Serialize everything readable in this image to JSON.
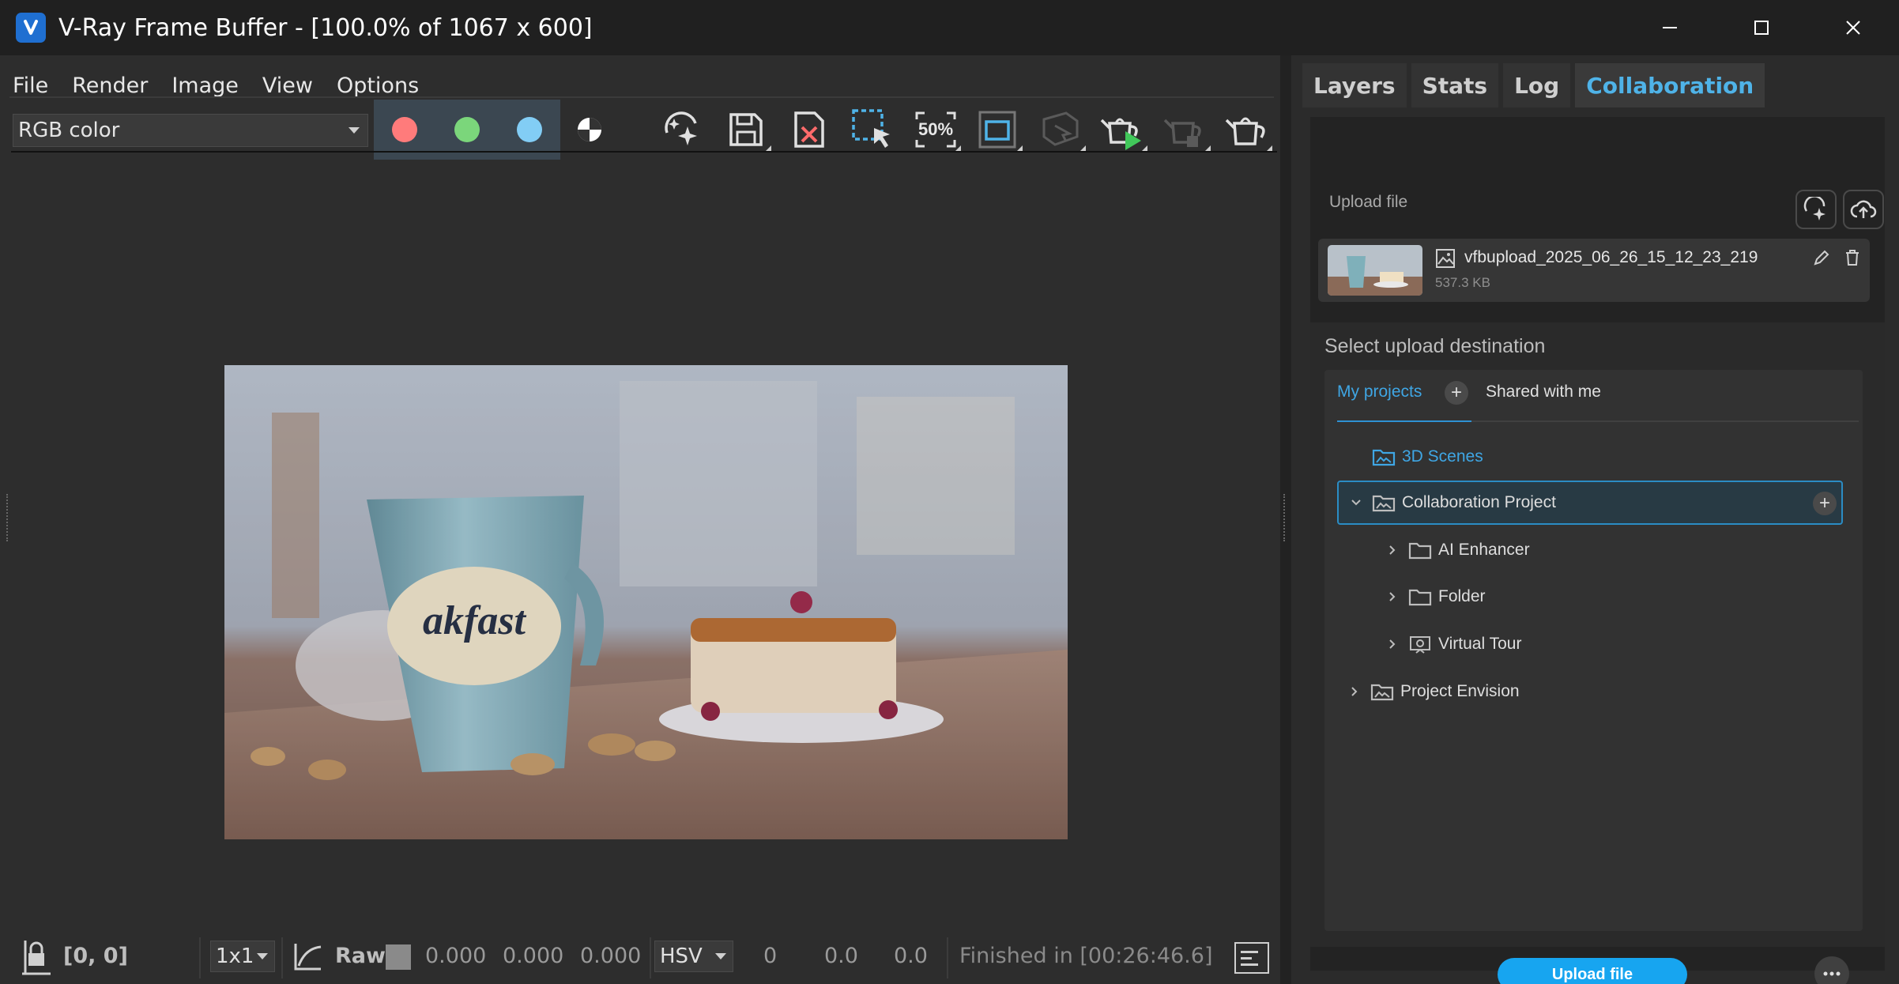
{
  "window": {
    "title": "V-Ray Frame Buffer - [100.0% of 1067 x 600]"
  },
  "menu": {
    "items": [
      "File",
      "Render",
      "Image",
      "View",
      "Options"
    ]
  },
  "toolbar": {
    "channel": "RGB color",
    "colors": {
      "red": "#ff7b7b",
      "green": "#7bd67b",
      "blue": "#82cdf5",
      "accent": "#2aa0e6"
    },
    "icons": [
      "ai-enhance-icon",
      "save-icon",
      "clear-image-icon",
      "region-select-icon",
      "zoom-50-icon",
      "render-region-icon",
      "interactive-teapot-icon",
      "render-teapot-icon",
      "stop-teapot-icon",
      "teapot-icon"
    ],
    "zoom_label": "50%"
  },
  "status": {
    "coords": "[0, 0]",
    "ratio": "1x1",
    "mode": "Raw",
    "r": "0.000",
    "g": "0.000",
    "b": "0.000",
    "colorspace": "HSV",
    "h": "0",
    "s": "0.0",
    "v": "0.0",
    "message": "Finished in [00:26:46.6]"
  },
  "panel": {
    "tabs": [
      "Layers",
      "Stats",
      "Log",
      "Collaboration"
    ],
    "active_tab": "Collaboration",
    "upload_label": "Upload file",
    "file": {
      "name": "vfbupload_2025_06_26_15_12_23_219",
      "size": "537.3 KB"
    },
    "destination_label": "Select upload destination",
    "project_tabs": [
      "My projects",
      "Shared with me"
    ],
    "tree": [
      {
        "label": "3D Scenes"
      },
      {
        "label": "Collaboration Project"
      },
      {
        "label": "AI Enhancer"
      },
      {
        "label": "Folder"
      },
      {
        "label": "Virtual Tour"
      },
      {
        "label": "Project Envision"
      }
    ],
    "upload_button": "Upload file"
  }
}
